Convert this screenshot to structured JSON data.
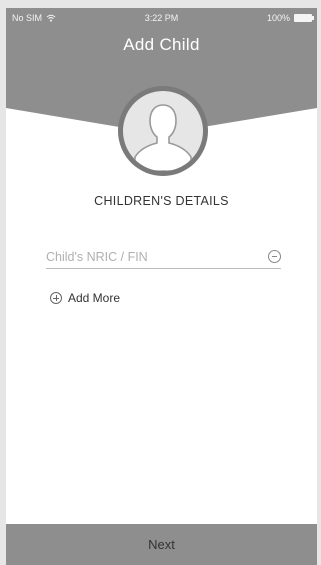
{
  "status_bar": {
    "carrier": "No SIM",
    "wifi_icon": "wifi-icon",
    "time": "3:22 PM",
    "battery": "100%",
    "battery_icon": "battery-icon"
  },
  "header": {
    "title": "Add Child",
    "avatar_icon": "person-silhouette-icon"
  },
  "section": {
    "title": "CHILDREN'S DETAILS"
  },
  "form": {
    "nric_placeholder": "Child's NRIC / FIN",
    "nric_value": "",
    "remove_icon": "minus-circle-icon",
    "add_more_icon": "plus-circle-icon",
    "add_more_label": "Add More"
  },
  "footer": {
    "next_label": "Next"
  },
  "colors": {
    "header_gray": "#8e8e8e",
    "avatar_ring": "#7a7a7a",
    "avatar_fill": "#e6e6e6",
    "button_gray": "#8e8e8e"
  }
}
